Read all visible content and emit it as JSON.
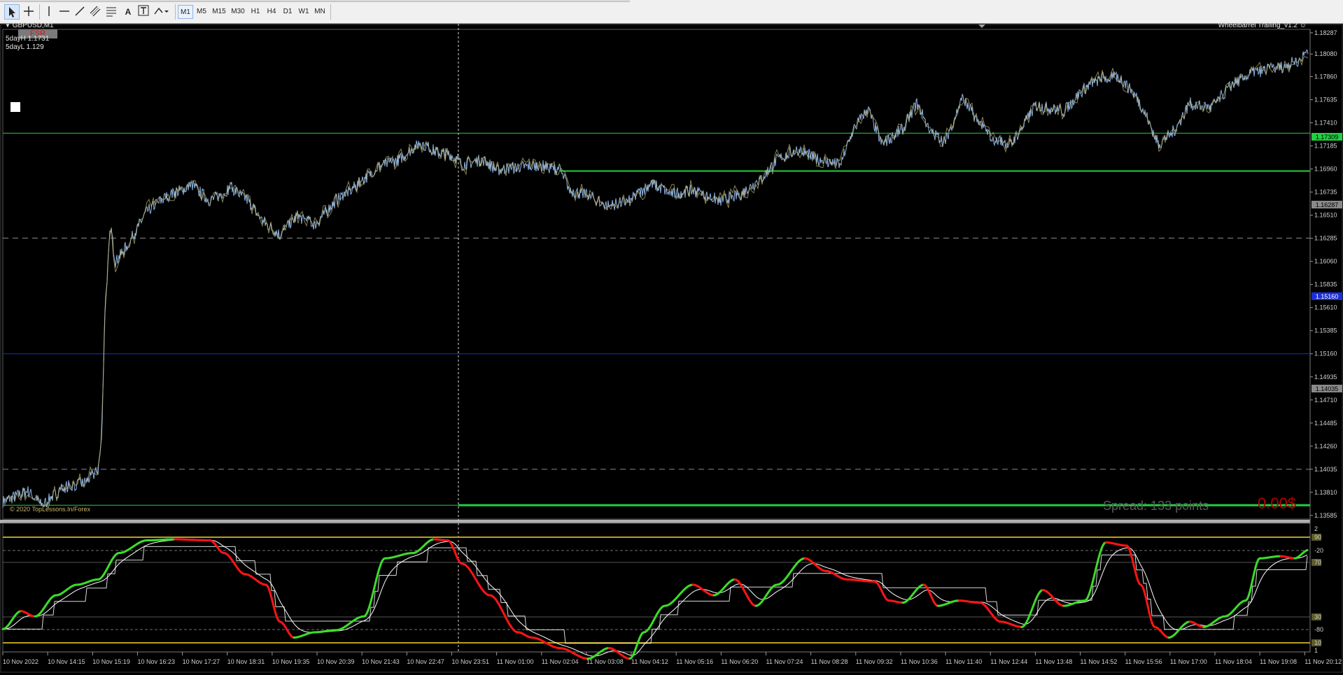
{
  "toolbar": {
    "timeframes": [
      "M1",
      "M5",
      "M15",
      "M30",
      "H1",
      "H4",
      "D1",
      "W1",
      "MN"
    ],
    "selected_timeframe": "M1",
    "tools": [
      {
        "icon": "cursor-icon",
        "label": ""
      },
      {
        "icon": "crosshair-icon",
        "label": ""
      },
      {
        "icon": "vertical-line-icon",
        "label": ""
      },
      {
        "icon": "horizontal-line-icon",
        "label": ""
      },
      {
        "icon": "trendline-icon",
        "label": ""
      },
      {
        "icon": "equidistant-channel-icon",
        "label": ""
      },
      {
        "icon": "fibonacci-icon",
        "label": ""
      },
      {
        "icon": "text-icon",
        "label": "A"
      },
      {
        "icon": "text-label-icon",
        "label": "T"
      },
      {
        "icon": "shapes-icon",
        "label": ""
      }
    ]
  },
  "chart": {
    "symbol_label": "GBPUSD,M1",
    "ea_label": "Wheelbarrel Trailing_v1.2",
    "fsr_label": "FSR",
    "five_day_high": "5dayH 1.1731",
    "five_day_low": "5dayL 1.129",
    "copyright": "© 2020 TopLessons.In/Forex",
    "spread_text": "Spread: 133 points",
    "profit_text": "0.00$",
    "price_axis": [
      "1.18287",
      "1.18080",
      "1.17860",
      "1.17635",
      "1.17410",
      "1.17185",
      "1.16960",
      "1.16735",
      "1.16510",
      "1.16285",
      "1.16060",
      "1.15835",
      "1.15610",
      "1.15385",
      "1.15160",
      "1.14935",
      "1.14710",
      "1.14485",
      "1.14260",
      "1.14035",
      "1.13810",
      "1.13585"
    ],
    "price_range": [
      1.1355,
      1.1832
    ],
    "tag_green": "1.17309",
    "tag_blue": "1.15160",
    "tag_gray_top": "1.16287",
    "tag_gray_bottom": "1.14035",
    "levels": {
      "green_upper": 1.17309,
      "green_mid": 1.1694,
      "blue": 1.1516,
      "gray_top": 1.16287,
      "gray_bottom": 1.14035,
      "green_bottom": 1.13685
    },
    "time_axis": [
      "10 Nov 2022",
      "10 Nov 14:15",
      "10 Nov 15:19",
      "10 Nov 16:23",
      "10 Nov 17:27",
      "10 Nov 18:31",
      "10 Nov 19:35",
      "10 Nov 20:39",
      "10 Nov 21:43",
      "10 Nov 22:47",
      "10 Nov 23:51",
      "11 Nov 01:00",
      "11 Nov 02:04",
      "11 Nov 03:08",
      "11 Nov 04:12",
      "11 Nov 05:16",
      "11 Nov 06:20",
      "11 Nov 07:24",
      "11 Nov 08:28",
      "11 Nov 09:32",
      "11 Nov 10:36",
      "11 Nov 11:40",
      "11 Nov 12:44",
      "11 Nov 13:48",
      "11 Nov 14:52",
      "11 Nov 15:56",
      "11 Nov 17:00",
      "11 Nov 18:04",
      "11 Nov 19:08",
      "11 Nov 20:12"
    ]
  },
  "indicator": {
    "axis_labels": [
      "2",
      "90",
      "-20",
      "70",
      "30",
      "-80",
      "10",
      "1"
    ]
  },
  "colors": {
    "price_line": "#8fb4e0",
    "price_line_alt": "#c8b868",
    "green_level": "#20d040",
    "blue_level": "#1b2fd8",
    "gray_level": "#8a8a8a",
    "osc_up": "#3cdc28",
    "osc_down": "#ff1414",
    "osc_slow": "#ffffff",
    "osc_band": "#b8a020",
    "spread_text": "#5a5a5a",
    "profit_text": "#b40000"
  }
}
